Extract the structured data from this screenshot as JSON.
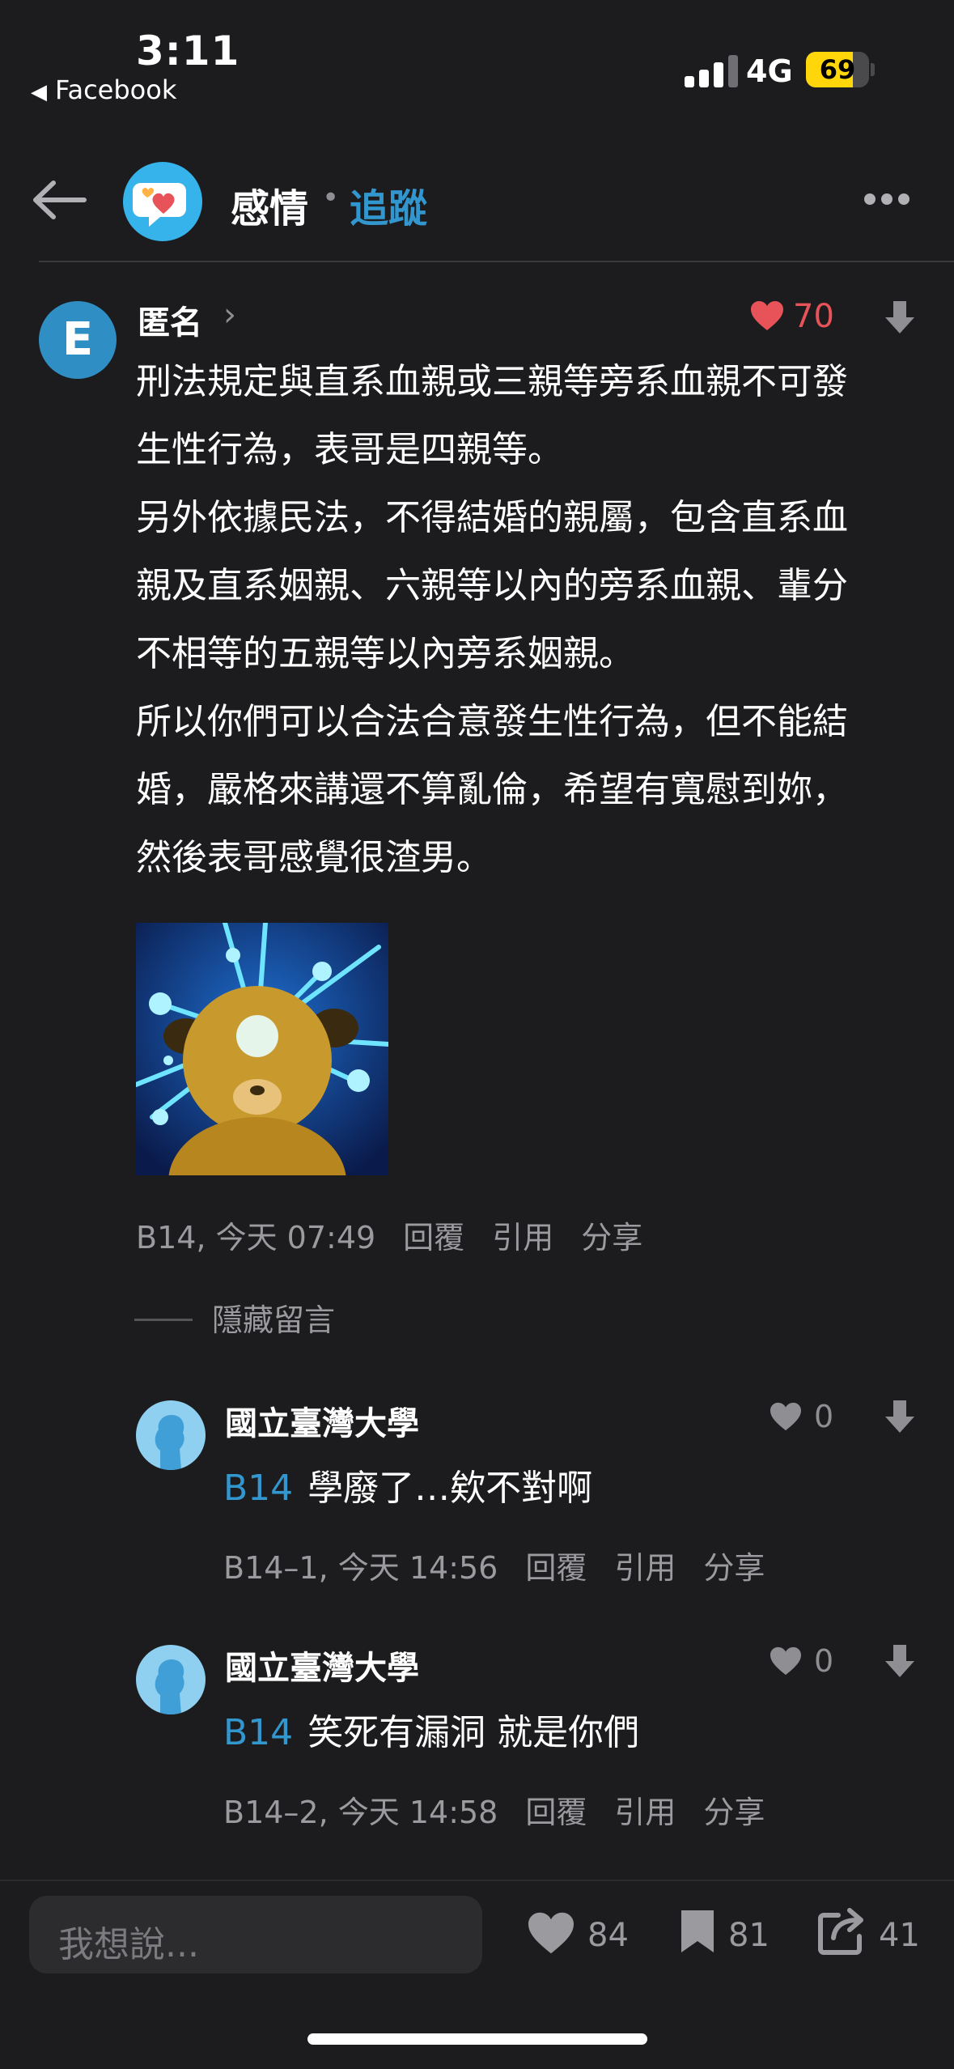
{
  "status_bar": {
    "time": "3:11",
    "back_app": "Facebook",
    "network": "4G",
    "battery": "69"
  },
  "nav": {
    "board_name": "感情",
    "separator": "•",
    "follow_label": "追蹤",
    "icons": [
      "back-arrow-icon",
      "board-icon",
      "more-icon"
    ]
  },
  "main_comment": {
    "avatar_letter": "E",
    "author": "匿名",
    "chevron": "›",
    "like_count": "70",
    "body_lines": [
      "刑法規定與直系血親或三親等旁系血親不可發",
      "生性行為，表哥是四親等。",
      "另外依據民法，不得結婚的親屬，包含直系血",
      "親及直系姻親、六親等以內的旁系血親、輩分",
      "不相等的五親等以內旁系姻親。",
      "所以你們可以合法合意發生性行為，但不能結",
      "婚，嚴格來講還不算亂倫，希望有寬慰到妳，",
      "然後表哥感覺很渣男。"
    ],
    "meta": "B14, 今天 07:49",
    "actions": {
      "reply": "回覆",
      "quote": "引用",
      "share": "分享"
    }
  },
  "hidden_label": "隱藏留言",
  "replies": [
    {
      "author": "國立臺灣大學",
      "like_count": "0",
      "ref": "B14",
      "text": "學廢了…欸不對啊",
      "meta": "B14–1, 今天 14:56",
      "actions": {
        "reply": "回覆",
        "quote": "引用",
        "share": "分享"
      }
    },
    {
      "author": "國立臺灣大學",
      "like_count": "0",
      "ref": "B14",
      "text": "笑死有漏洞 就是你們",
      "meta": "B14–2, 今天 14:58",
      "actions": {
        "reply": "回覆",
        "quote": "引用",
        "share": "分享"
      }
    }
  ],
  "bottom_bar": {
    "input_placeholder": "我想說...",
    "like_count": "84",
    "bookmark_count": "81",
    "share_count": "41"
  },
  "colors": {
    "background": "#1c1c1e",
    "accent_blue": "#3397cf",
    "like_red": "#e8535a",
    "battery_yellow": "#ffd60a"
  }
}
